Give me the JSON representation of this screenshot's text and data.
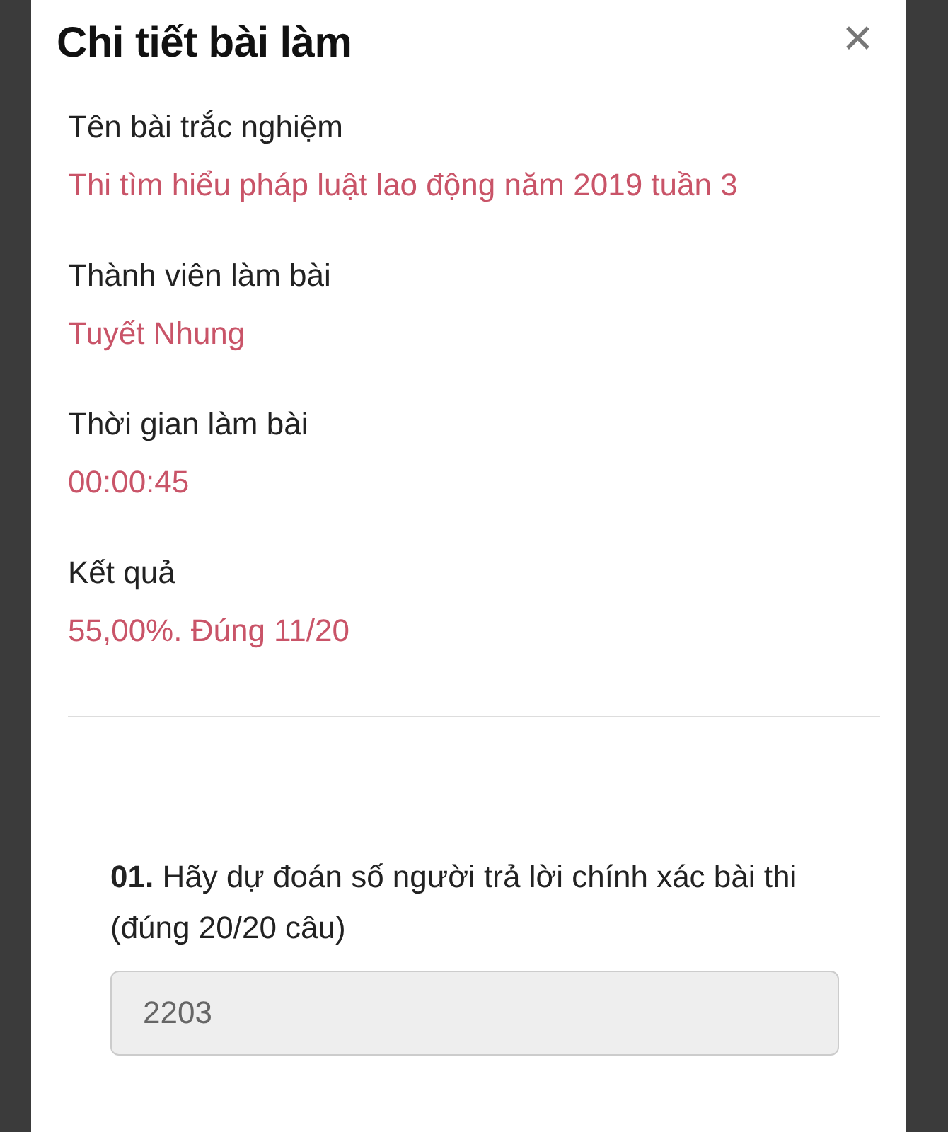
{
  "dialog": {
    "title": "Chi tiết bài làm",
    "close": "✕"
  },
  "fields": [
    {
      "label": "Tên bài trắc nghiệm",
      "value": "Thi tìm hiểu pháp luật lao động năm 2019 tuần 3"
    },
    {
      "label": "Thành viên làm bài",
      "value": "Tuyết Nhung"
    },
    {
      "label": "Thời gian làm bài",
      "value": "00:00:45"
    },
    {
      "label": "Kết quả",
      "value": "55,00%. Đúng 11/20"
    }
  ],
  "questions": [
    {
      "text": "**01.** Hãy dự đoán số người trả lời chính xác bài thi (đúng 20/20 câu)",
      "answer": "2203"
    }
  ]
}
